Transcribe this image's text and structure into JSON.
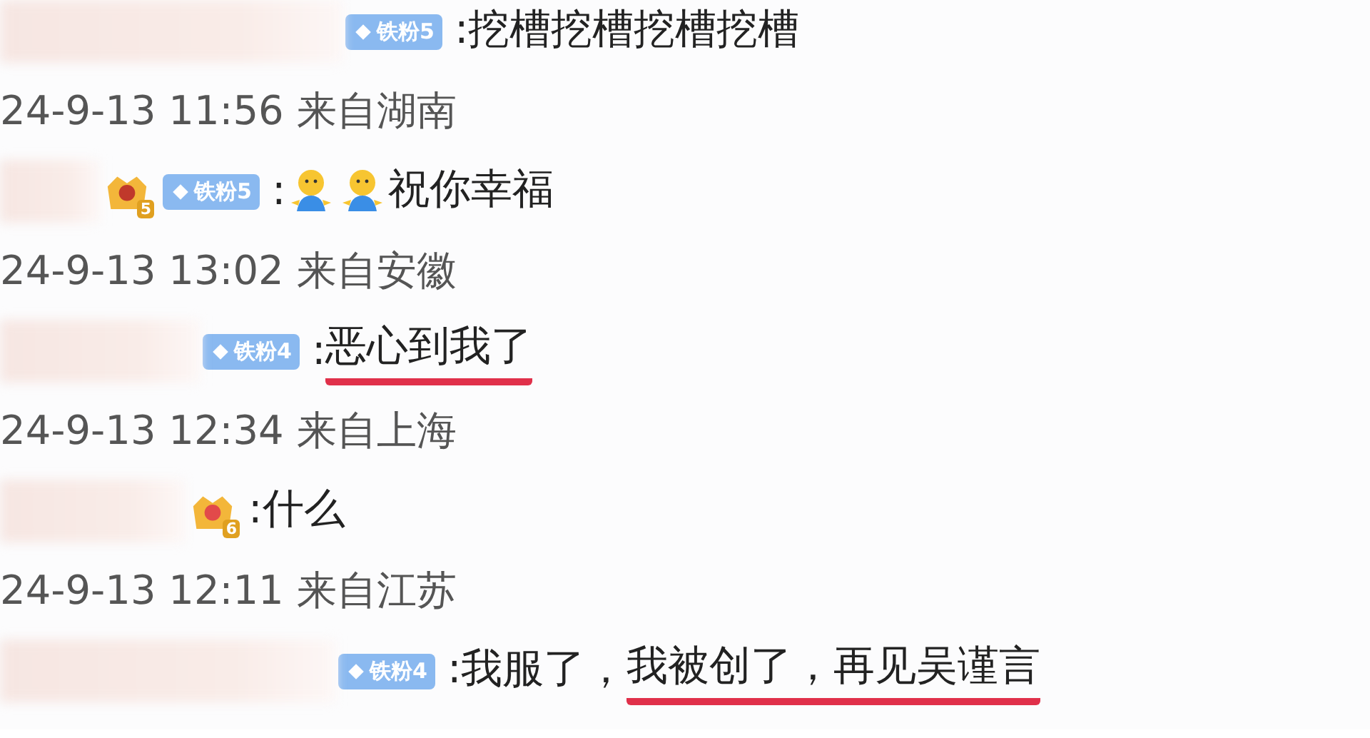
{
  "comments": [
    {
      "badges": [
        {
          "kind": "fan",
          "label": "铁粉5"
        }
      ],
      "parts": [
        {
          "text": ":挖槽挖槽挖槽挖槽",
          "marked": false
        }
      ],
      "time": "24-9-13 11:56 来自湖南"
    },
    {
      "badges": [
        {
          "kind": "crest",
          "label": "5"
        },
        {
          "kind": "fan",
          "label": "铁粉5"
        }
      ],
      "parts": [
        {
          "text": ":",
          "marked": false
        },
        {
          "kind": "emoji"
        },
        {
          "kind": "emoji"
        },
        {
          "text": "祝你幸福",
          "marked": false
        }
      ],
      "time": "24-9-13 13:02 来自安徽"
    },
    {
      "badges": [
        {
          "kind": "fan",
          "label": "铁粉4"
        }
      ],
      "parts": [
        {
          "text": ":",
          "marked": false
        },
        {
          "text": "恶心到我了",
          "marked": true
        }
      ],
      "time": "24-9-13 12:34 来自上海"
    },
    {
      "badges": [
        {
          "kind": "crown",
          "label": "6"
        }
      ],
      "parts": [
        {
          "text": ":什么",
          "marked": false
        }
      ],
      "time": "24-9-13 12:11 来自江苏"
    },
    {
      "badges": [
        {
          "kind": "fan",
          "label": "铁粉4"
        }
      ],
      "parts": [
        {
          "text": ":我服了，",
          "marked": false
        },
        {
          "text": "我被创了，再见吴谨言",
          "marked": true
        }
      ]
    }
  ]
}
